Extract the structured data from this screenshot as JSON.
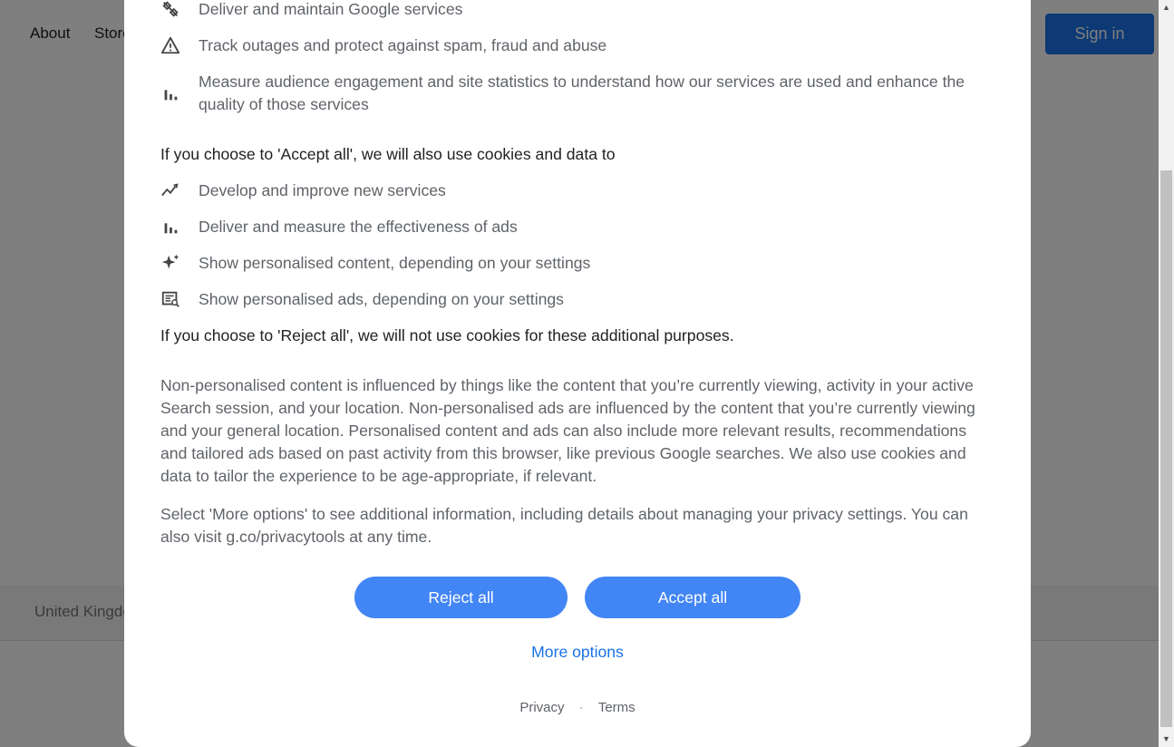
{
  "background": {
    "nav": {
      "about": "About",
      "store": "Store",
      "sign_in": "Sign in"
    },
    "footer": {
      "country": "United Kingdom"
    }
  },
  "dialog": {
    "always_items": [
      {
        "icon": "tools-icon",
        "text": "Deliver and maintain Google services"
      },
      {
        "icon": "warning-icon",
        "text": "Track outages and protect against spam, fraud and abuse"
      },
      {
        "icon": "bar-chart-icon",
        "text": "Measure audience engagement and site statistics to understand how our services are used and enhance the quality of those services"
      }
    ],
    "accept_heading": "If you choose to 'Accept all', we will also use cookies and data to",
    "accept_items": [
      {
        "icon": "trending-icon",
        "text": "Develop and improve new services"
      },
      {
        "icon": "bar-chart-icon",
        "text": "Deliver and measure the effectiveness of ads"
      },
      {
        "icon": "sparkle-icon",
        "text": "Show personalised content, depending on your settings"
      },
      {
        "icon": "ad-icon",
        "text": "Show personalised ads, depending on your settings"
      }
    ],
    "reject_note": "If you choose to 'Reject all', we will not use cookies for these additional purposes.",
    "nonpersonalised_paragraph": "Non-personalised content is influenced by things like the content that you’re currently viewing, activity in your active Search session, and your location. Non-personalised ads are influenced by the content that you’re currently viewing and your general location. Personalised content and ads can also include more relevant results, recommendations and tailored ads based on past activity from this browser, like previous Google searches. We also use cookies and data to tailor the experience to be age-appropriate, if relevant.",
    "more_options_paragraph": "Select 'More options' to see additional information, including details about managing your privacy settings. You can also visit g.co/privacytools at any time.",
    "reject_button": "Reject all",
    "accept_button": "Accept all",
    "more_options_link": "More options",
    "footer": {
      "privacy": "Privacy",
      "separator": "·",
      "terms": "Terms"
    }
  },
  "colors": {
    "accent": "#4285f4",
    "link": "#1a73e8",
    "scrim": "rgba(0,0,0,0.5)"
  }
}
